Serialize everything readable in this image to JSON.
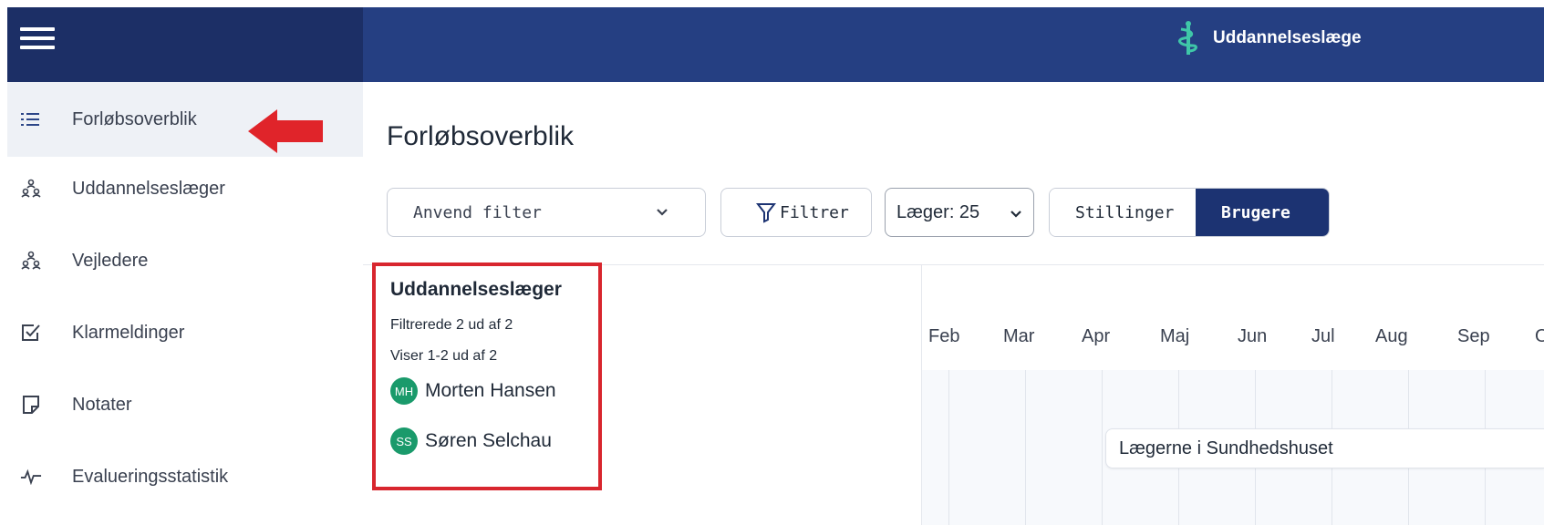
{
  "app": {
    "name": "Uddannelseslæge"
  },
  "sidebar": {
    "items": [
      {
        "label": "Forløbsoverblik",
        "icon": "list-icon",
        "active": true
      },
      {
        "label": "Uddannelseslæger",
        "icon": "users-icon"
      },
      {
        "label": "Vejledere",
        "icon": "users-icon"
      },
      {
        "label": "Klarmeldinger",
        "icon": "checkbox-icon"
      },
      {
        "label": "Notater",
        "icon": "note-icon"
      },
      {
        "label": "Evalueringsstatistik",
        "icon": "pulse-icon"
      }
    ]
  },
  "page": {
    "title": "Forløbsoverblik"
  },
  "filters": {
    "apply_filter_label": "Anvend filter",
    "filter_button_label": "Filtrer",
    "doctors_select_value": "Læger: 25",
    "view_toggle": {
      "options": [
        "Stillinger",
        "Brugere"
      ],
      "selected": "Brugere"
    }
  },
  "trainees": {
    "title": "Uddannelseslæger",
    "filtered_text": "Filtrerede 2 ud af 2",
    "showing_text": "Viser 1-2 ud af 2",
    "people": [
      {
        "initials": "MH",
        "name": "Morten Hansen"
      },
      {
        "initials": "SS",
        "name": "Søren Selchau"
      }
    ]
  },
  "timeline": {
    "months": [
      "Feb",
      "Mar",
      "Apr",
      "Maj",
      "Jun",
      "Jul",
      "Aug",
      "Sep",
      "O"
    ],
    "event_label": "Lægerne i Sundhedshuset"
  },
  "colors": {
    "header": "#253f82",
    "sidebar_header": "#1c2f66",
    "accent": "#1c3372",
    "avatar": "#1a9a6b",
    "highlight": "#d8262e"
  }
}
